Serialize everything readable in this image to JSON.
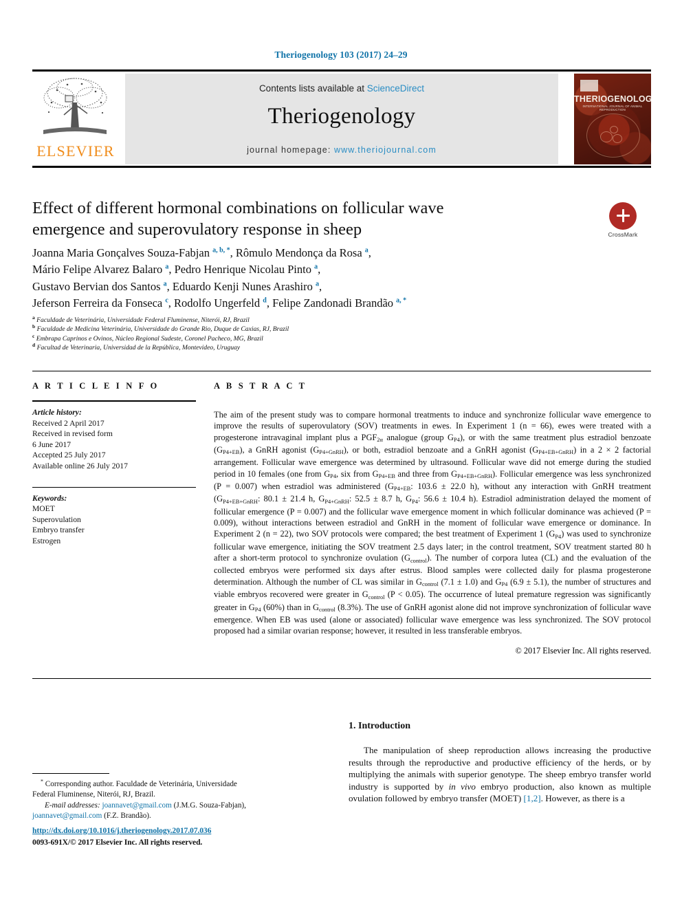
{
  "running_head": "Theriogenology 103 (2017) 24–29",
  "masthead": {
    "contents_prefix": "Contents lists available at ",
    "sciencedirect": "ScienceDirect",
    "journal_name": "Theriogenology",
    "homepage_prefix": "journal homepage: ",
    "homepage_url": "www.theriojournal.com",
    "publisher_logo_text": "ELSEVIER",
    "cover_title": "THERIOGENOLOGY",
    "cover_subtitle": "INTERNATIONAL JOURNAL OF ANIMAL REPRODUCTION"
  },
  "article": {
    "title": "Effect of different hormonal combinations on follicular wave emergence and superovulatory response in sheep",
    "crossmark_label": "CrossMark",
    "authors_html": "Joanna Maria Gonçalves Souza-Fabjan <sup>a, b, *</sup>, Rômulo Mendonça da Rosa <sup>a</sup>,<br>Mário Felipe Alvarez Balaro <sup>a</sup>, Pedro Henrique Nicolau Pinto <sup>a</sup>,<br>Gustavo Bervian dos Santos <sup>a</sup>, Eduardo Kenji Nunes Arashiro <sup>a</sup>,<br>Jeferson Ferreira da Fonseca <sup>c</sup>, Rodolfo Ungerfeld <sup>d</sup>, Felipe Zandonadi Brandão <sup>a, *</sup>",
    "affiliations": [
      {
        "marker": "a",
        "text": "Faculdade de Veterinária, Universidade Federal Fluminense, Niterói, RJ, Brazil"
      },
      {
        "marker": "b",
        "text": "Faculdade de Medicina Veterinária, Universidade do Grande Rio, Duque de Caxias, RJ, Brazil"
      },
      {
        "marker": "c",
        "text": "Embrapa Caprinos e Ovinos, Núcleo Regional Sudeste, Coronel Pacheco, MG, Brazil"
      },
      {
        "marker": "d",
        "text": "Facultad de Veterinaria, Universidad de la República, Montevideo, Uruguay"
      }
    ]
  },
  "article_info": {
    "heading": "A R T I C L E  I N F O",
    "history_label": "Article history:",
    "history": [
      "Received 2 April 2017",
      "Received in revised form",
      "6 June 2017",
      "Accepted 25 July 2017",
      "Available online 26 July 2017"
    ],
    "keywords_label": "Keywords:",
    "keywords": [
      "MOET",
      "Superovulation",
      "Embryo transfer",
      "Estrogen"
    ]
  },
  "abstract": {
    "heading": "A B S T R A C T",
    "body_html": "The aim of the present study was to compare hormonal treatments to induce and synchronize follicular wave emergence to improve the results of superovulatory (SOV) treatments in ewes. In Experiment 1 (n = 66), ewes were treated with a progesterone intravaginal implant plus a PGF<sub>2α</sub> analogue (group G<sub>P4</sub>), or with the same treatment plus estradiol benzoate (G<sub>P4+EB</sub>), a GnRH agonist (G<sub>P4+GnRH</sub>), or both, estradiol benzoate and a GnRH agonist (G<sub>P4+EB+GnRH</sub>) in a 2 × 2 factorial arrangement. Follicular wave emergence was determined by ultrasound. Follicular wave did not emerge during the studied period in 10 females (one from G<sub>P4</sub>, six from G<sub>P4+EB</sub> and three from G<sub>P4+EB+GnRH</sub>). Follicular emergence was less synchronized (P = 0.007) when estradiol was administered (G<sub>P4+EB</sub>: 103.6 ± 22.0 h), without any interaction with GnRH treatment (G<sub>P4+EB+GnRH</sub>: 80.1 ± 21.4 h, G<sub>P4+GnRH</sub>: 52.5 ± 8.7 h, G<sub>P4</sub>: 56.6 ± 10.4 h). Estradiol administration delayed the moment of follicular emergence (P = 0.007) and the follicular wave emergence moment in which follicular dominance was achieved (P = 0.009), without interactions between estradiol and GnRH in the moment of follicular wave emergence or dominance. In Experiment 2 (n = 22), two SOV protocols were compared; the best treatment of Experiment 1 (G<sub>P4</sub>) was used to synchronize follicular wave emergence, initiating the SOV treatment 2.5 days later; in the control treatment, SOV treatment started 80 h after a short-term protocol to synchronize ovulation (G<sub>control</sub>). The number of corpora lutea (CL) and the evaluation of the collected embryos were performed six days after estrus. Blood samples were collected daily for plasma progesterone determination. Although the number of CL was similar in G<sub>control</sub> (7.1 ± 1.0) and G<sub>P4</sub> (6.9 ± 5.1), the number of structures and viable embryos recovered were greater in G<sub>control</sub> (P &lt; 0.05). The occurrence of luteal premature regression was significantly greater in G<sub>P4</sub> (60%) than in G<sub>control</sub> (8.3%). The use of GnRH agonist alone did not improve synchronization of follicular wave emergence. When EB was used (alone or associated) follicular wave emergence was less synchronized. The SOV protocol proposed had a similar ovarian response; however, it resulted in less transferable embryos.",
    "copyright": "© 2017 Elsevier Inc. All rights reserved."
  },
  "introduction": {
    "heading": "1. Introduction",
    "body_html": "The manipulation of sheep reproduction allows increasing the productive results through the reproductive and productive efficiency of the herds, or by multiplying the animals with superior genotype. The sheep embryo transfer world industry is supported by <i>in vivo</i> embryo production, also known as multiple ovulation followed by embryo transfer (MOET) <span class=\"cite\">[1,2]</span>. However, as there is a"
  },
  "footnotes": {
    "corresponding_html": "<sup>*</sup> Corresponding author. Faculdade de Veterinária, Universidade Federal Fluminense, Niterói, RJ, Brazil.",
    "emails_html": "<span class=\"em-lead\">E-mail addresses:</span> <span class=\"mail\">joannavet@gmail.com</span> (J.M.G. Souza-Fabjan), <span class=\"mail\">joannavet@gmail.com</span> (F.Z. Brandão)."
  },
  "footer": {
    "doi": "http://dx.doi.org/10.1016/j.theriogenology.2017.07.036",
    "issn_line": "0093-691X/© 2017 Elsevier Inc. All rights reserved."
  },
  "colors": {
    "link_blue": "#1073a8",
    "sciencedirect_blue": "#2a8dc4",
    "elsevier_orange": "#F08C1B",
    "crossmark_red": "#b02a25",
    "cover_maroon": "#5d1a0e"
  }
}
